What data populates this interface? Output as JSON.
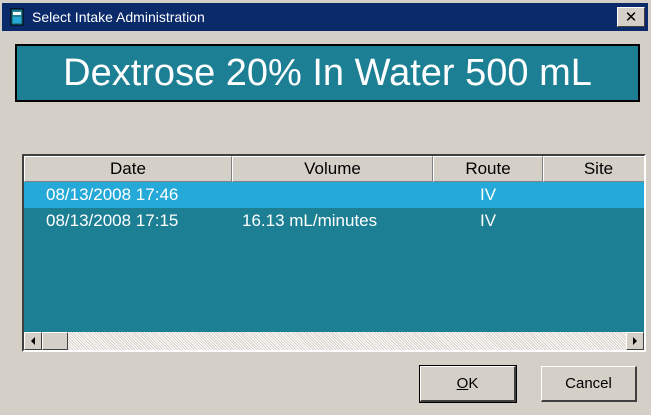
{
  "window": {
    "title": "Select Intake Administration",
    "close_glyph": "✕"
  },
  "drug": {
    "name": "Dextrose 20% In Water 500 mL"
  },
  "table": {
    "columns": [
      "Date",
      "Volume",
      "Route",
      "Site"
    ],
    "rows": [
      {
        "date": "08/13/2008 17:46",
        "volume": "",
        "route": "IV",
        "site": "",
        "selected": true
      },
      {
        "date": "08/13/2008 17:15",
        "volume": "16.13 mL/minutes",
        "route": "IV",
        "site": "",
        "selected": false
      }
    ]
  },
  "buttons": {
    "ok_accel": "O",
    "ok_rest": "K",
    "cancel": "Cancel"
  },
  "icons": {
    "app": "app-icon",
    "close": "close-icon",
    "scroll_left": "scroll-left-arrow-icon",
    "scroll_right": "scroll-right-arrow-icon"
  },
  "colors": {
    "titlebar": "#0a2a6a",
    "banner": "#1c7f94",
    "list_background": "#1c7f94",
    "selected_row": "#25a9d8"
  }
}
